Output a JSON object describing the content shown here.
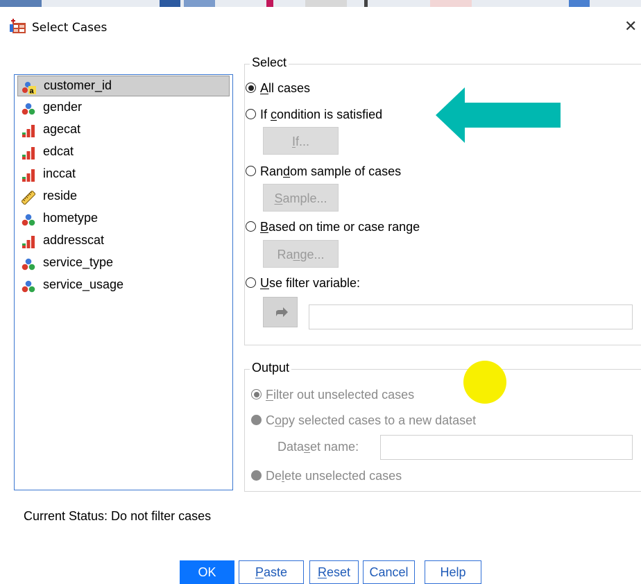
{
  "window": {
    "title": "Select Cases"
  },
  "icons": {
    "app": "select-cases-icon",
    "close": "close-icon"
  },
  "variables": [
    {
      "label": "customer_id",
      "icon": "string-nominal-icon",
      "selected": true
    },
    {
      "label": "gender",
      "icon": "nominal-icon"
    },
    {
      "label": "agecat",
      "icon": "ordinal-icon"
    },
    {
      "label": "edcat",
      "icon": "ordinal-icon"
    },
    {
      "label": "inccat",
      "icon": "ordinal-icon"
    },
    {
      "label": "reside",
      "icon": "scale-icon"
    },
    {
      "label": "hometype",
      "icon": "nominal-icon"
    },
    {
      "label": "addresscat",
      "icon": "ordinal-icon"
    },
    {
      "label": "service_type",
      "icon": "nominal-icon"
    },
    {
      "label": "service_usage",
      "icon": "nominal-icon"
    }
  ],
  "select": {
    "title": "Select",
    "all_cases": {
      "pre": "",
      "u": "A",
      "post": "ll cases",
      "checked": true
    },
    "if_condition": {
      "pre": "If ",
      "u": "c",
      "post": "ondition is satisfied"
    },
    "if_button": {
      "pre": "",
      "u": "I",
      "post": "f..."
    },
    "random": {
      "pre": "Ran",
      "u": "d",
      "post": "om sample of cases"
    },
    "sample_button": {
      "pre": "",
      "u": "S",
      "post": "ample..."
    },
    "time_range": {
      "pre": "",
      "u": "B",
      "post": "ased on time or case range"
    },
    "range_button": {
      "pre": "Ra",
      "u": "n",
      "post": "ge..."
    },
    "filter_var": {
      "pre": "",
      "u": "U",
      "post": "se filter variable:"
    },
    "filter_value": ""
  },
  "output": {
    "title": "Output",
    "filter_out": {
      "pre": "",
      "u": "F",
      "post": "ilter out unselected cases",
      "checked": true
    },
    "copy": {
      "pre": "C",
      "u": "o",
      "post": "py selected cases to a new dataset"
    },
    "dataset_name": {
      "pre": "Data",
      "u": "s",
      "post": "et name:"
    },
    "dataset_value": "",
    "delete": {
      "pre": "De",
      "u": "l",
      "post": "ete unselected cases"
    }
  },
  "status": "Current Status: Do not filter cases",
  "buttons": {
    "ok": "OK",
    "paste": {
      "pre": "",
      "u": "P",
      "post": "aste"
    },
    "reset": {
      "pre": "",
      "u": "R",
      "post": "eset"
    },
    "cancel": "Cancel",
    "help": "Help"
  },
  "colors": {
    "accent": "#0a74ff",
    "list_border": "#3a77d0",
    "annotation_arrow": "#00b8b0",
    "annotation_dot": "#f8f000",
    "disabled_text": "#8a8a8a"
  }
}
